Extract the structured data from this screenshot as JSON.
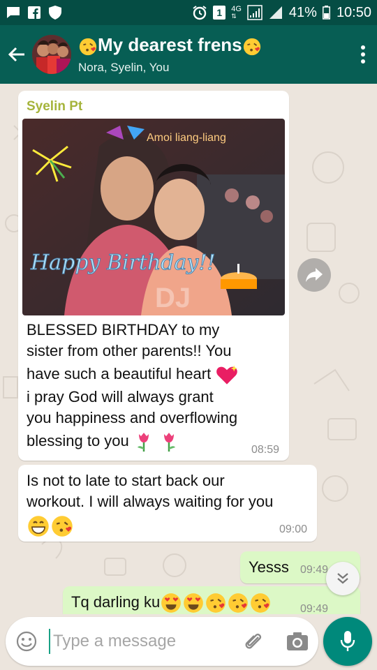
{
  "status_bar": {
    "battery_percent": "41%",
    "time": "10:50",
    "sim": "1",
    "network": "4G"
  },
  "header": {
    "title": "My dearest frens",
    "members": "Nora, Syelin, You"
  },
  "messages": [
    {
      "sender": "Syelin Pt",
      "photo_overlay_top": "Amoi liang-liang",
      "photo_overlay_main": "Happy Birthday!!",
      "lines": [
        "BLESSED BIRTHDAY to my",
        "sister from other parents!! You",
        "have such a beautiful heart",
        "i pray God will always grant",
        "you happiness and overflowing",
        "blessing to you"
      ],
      "time": "08:59"
    },
    {
      "lines": [
        "Is not to late to start back our",
        "workout. I will always waiting for you"
      ],
      "time": "09:00"
    },
    {
      "text": "Yesss",
      "time": "09:49"
    },
    {
      "text": "Tq darling ku",
      "time": "09:49"
    }
  ],
  "input": {
    "placeholder": "Type a message"
  },
  "colors": {
    "header": "#075e54",
    "status_bar": "#054d44",
    "incoming_bubble": "#ffffff",
    "outgoing_bubble": "#dcf8c6",
    "sender_name": "#a5b43b",
    "accent": "#00897b",
    "chat_background": "#ece5dd"
  },
  "icons": {
    "header_title_emoji": "kissing-face-emoji",
    "heart": "sparkling-heart-emoji",
    "flower": "tulip-emoji",
    "reply_emojis": [
      "grinning-face-emoji",
      "kissing-face-emoji"
    ],
    "tq_emojis": [
      "heart-eyes-emoji",
      "heart-eyes-emoji",
      "kissing-face-emoji",
      "kissing-face-emoji",
      "kissing-face-emoji"
    ]
  }
}
